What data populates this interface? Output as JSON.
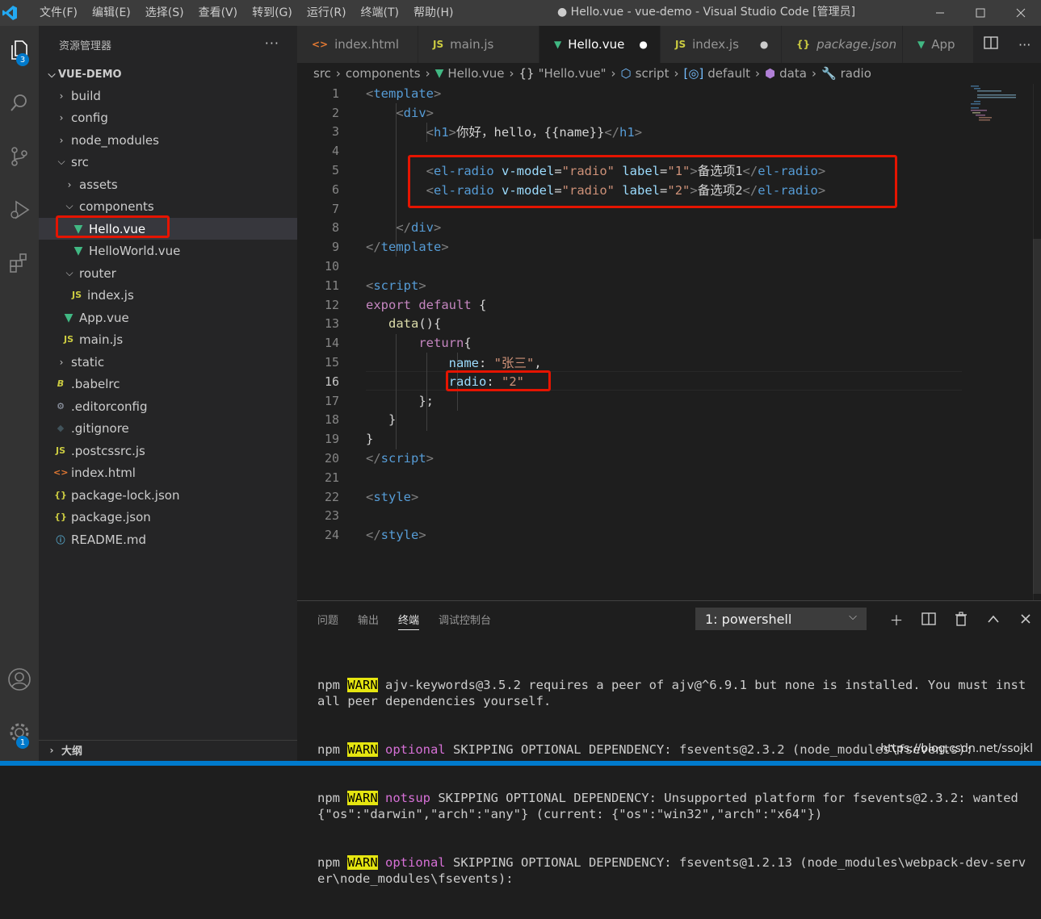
{
  "menu": [
    "文件(F)",
    "编辑(E)",
    "选择(S)",
    "查看(V)",
    "转到(G)",
    "运行(R)",
    "终端(T)",
    "帮助(H)"
  ],
  "window_title": "● Hello.vue - vue-demo - Visual Studio Code [管理员]",
  "activity": {
    "explorer_badge": "3",
    "settings_badge": "1"
  },
  "sidebar": {
    "header": "资源管理器",
    "more": "···",
    "root": "VUE-DEMO",
    "items": [
      {
        "label": "build",
        "type": "folder"
      },
      {
        "label": "config",
        "type": "folder"
      },
      {
        "label": "node_modules",
        "type": "folder"
      },
      {
        "label": "src",
        "type": "folder-open"
      },
      {
        "label": "assets",
        "type": "folder"
      },
      {
        "label": "components",
        "type": "folder-open"
      },
      {
        "label": "Hello.vue",
        "type": "vue"
      },
      {
        "label": "HelloWorld.vue",
        "type": "vue"
      },
      {
        "label": "router",
        "type": "folder-open"
      },
      {
        "label": "index.js",
        "type": "js"
      },
      {
        "label": "App.vue",
        "type": "vue"
      },
      {
        "label": "main.js",
        "type": "js"
      },
      {
        "label": "static",
        "type": "folder"
      },
      {
        "label": ".babelrc",
        "type": "babel"
      },
      {
        "label": ".editorconfig",
        "type": "gear"
      },
      {
        "label": ".gitignore",
        "type": "git"
      },
      {
        "label": ".postcssrc.js",
        "type": "js"
      },
      {
        "label": "index.html",
        "type": "html"
      },
      {
        "label": "package-lock.json",
        "type": "json"
      },
      {
        "label": "package.json",
        "type": "json"
      },
      {
        "label": "README.md",
        "type": "info"
      }
    ],
    "outline": "大纲"
  },
  "tabs": [
    {
      "label": "index.html",
      "icon": "<>"
    },
    {
      "label": "main.js",
      "icon": "JS"
    },
    {
      "label": "Hello.vue",
      "icon": "V",
      "active": true,
      "dirty": true
    },
    {
      "label": "index.js",
      "icon": "JS",
      "dirty": true
    },
    {
      "label": "package.json",
      "icon": "{}"
    },
    {
      "label": "App",
      "icon": "V"
    }
  ],
  "breadcrumb": [
    "src",
    "components",
    "Hello.vue",
    "\"Hello.vue\"",
    "script",
    "default",
    "data",
    "radio"
  ],
  "editor": {
    "current_line": 16,
    "line_count": 24
  },
  "panel": {
    "tabs": [
      "问题",
      "输出",
      "终端",
      "调试控制台"
    ],
    "active_tab": "终端",
    "terminal_select": "1: powershell",
    "terminal_lines": [
      {
        "prefix": "npm ",
        "warn": "WARN",
        "tag": "",
        "text": " ajv-keywords@3.5.2 requires a peer of ajv@^6.9.1 but none is installed. You must install peer dependencies yourself."
      },
      {
        "prefix": "npm ",
        "warn": "WARN",
        "tag": " optional",
        "text": " SKIPPING OPTIONAL DEPENDENCY: fsevents@2.3.2 (node_modules\\fsevents):"
      },
      {
        "prefix": "npm ",
        "warn": "WARN",
        "tag": " notsup",
        "text": " SKIPPING OPTIONAL DEPENDENCY: Unsupported platform for fsevents@2.3.2: wanted {\"os\":\"darwin\",\"arch\":\"any\"} (current: {\"os\":\"win32\",\"arch\":\"x64\"})"
      },
      {
        "prefix": "npm ",
        "warn": "WARN",
        "tag": " optional",
        "text": " SKIPPING OPTIONAL DEPENDENCY: fsevents@1.2.13 (node_modules\\webpack-dev-server\\node_modules\\fsevents):"
      }
    ]
  },
  "watermark": "https://blog.csdn.net/ssojkl",
  "colors": {
    "accent": "#007acc",
    "highlight_box": "#e51400",
    "vue_green": "#41b883",
    "warn_bg": "#e5e510"
  }
}
